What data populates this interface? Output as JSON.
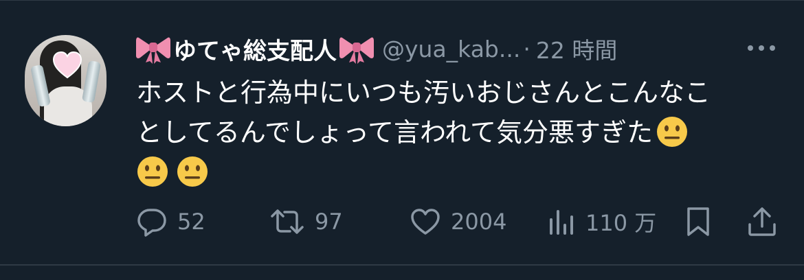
{
  "tweet": {
    "display_name": "ゆてゃ総支配人",
    "handle": "@yua_kab...",
    "separator": "·",
    "time": "22 時間",
    "text_lines": [
      "ホストと行為中にいつも汚いおじさんとこんなこ",
      "としてるんでしょって言われて気分悪すぎた"
    ],
    "emoji_names": [
      "neutral-face-emoji",
      "neutral-face-emoji",
      "neutral-face-emoji"
    ]
  },
  "actions": {
    "replies": "52",
    "reposts": "97",
    "likes": "2004",
    "views": "110 万"
  },
  "colors": {
    "background": "#15202b",
    "muted_text": "#8b98a5",
    "primary_text": "#ffffff",
    "ribbon": "#f08fb0",
    "emoji_face": "#f7c94a"
  },
  "icons": [
    "more-icon",
    "reply-icon",
    "repost-icon",
    "like-icon",
    "views-icon",
    "bookmark-icon",
    "share-icon"
  ]
}
